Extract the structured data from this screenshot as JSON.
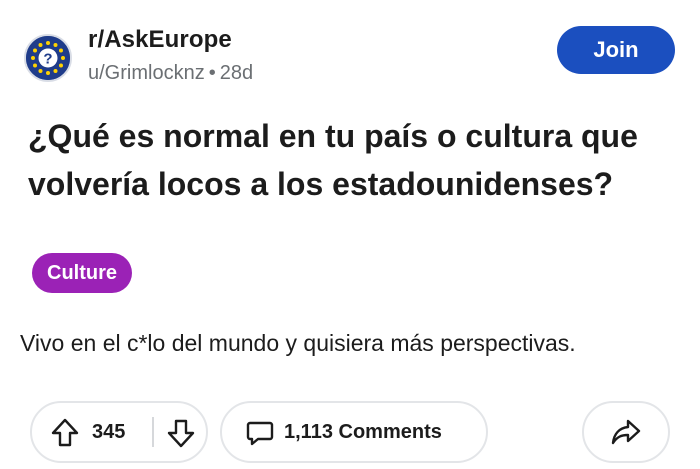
{
  "post": {
    "subreddit": "r/AskEurope",
    "author": "u/Grimlocknz",
    "separator": "•",
    "age": "28d",
    "join_label": "Join",
    "title": "¿Qué es normal en tu país o cultura que volvería locos a los estadounidenses?",
    "flair": "Culture",
    "body": "Vivo en el c*lo del mundo y quisiera más perspectivas."
  },
  "actions": {
    "score": "345",
    "comments_label": "1,113 Comments"
  },
  "icons": {
    "avatar": "subreddit-avatar-eu-stars-question",
    "upvote": "arrow-up-icon",
    "downvote": "arrow-down-icon",
    "comments": "speech-bubble-icon",
    "share": "share-arrow-icon"
  },
  "colors": {
    "join_button": "#1b4fbf",
    "flair_background": "#9b22b6",
    "avatar_background": "#1f3c8a"
  }
}
